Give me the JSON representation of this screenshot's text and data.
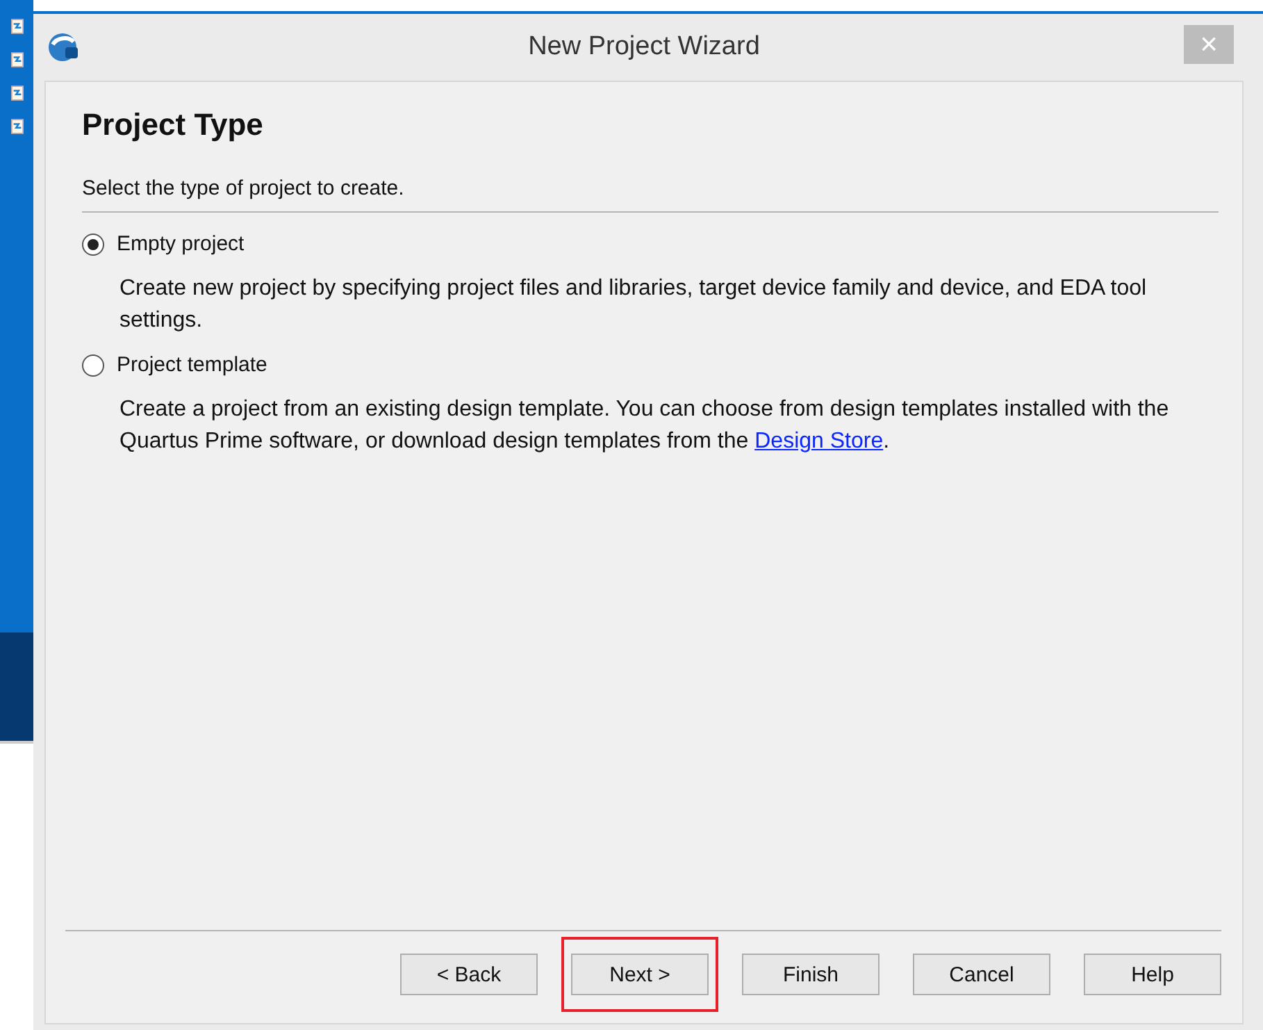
{
  "window": {
    "title": "New Project Wizard",
    "close": "×"
  },
  "page": {
    "heading": "Project Type",
    "instruction": "Select the type of project to create."
  },
  "options": [
    {
      "label": "Empty project",
      "selected": true,
      "description": "Create new project by specifying project files and libraries, target device family and device, and EDA tool settings."
    },
    {
      "label": "Project template",
      "selected": false,
      "description": "Create a project from an existing design template. You can choose from design templates installed with the Quartus Prime software, or download design templates from the",
      "link": "Design Store",
      "after": "."
    }
  ],
  "buttons": [
    {
      "label": "< Back",
      "highlighted": false
    },
    {
      "label": "Next >",
      "highlighted": true
    },
    {
      "label": "Finish",
      "highlighted": false
    },
    {
      "label": "Cancel",
      "highlighted": false
    },
    {
      "label": "Help",
      "highlighted": false
    }
  ]
}
